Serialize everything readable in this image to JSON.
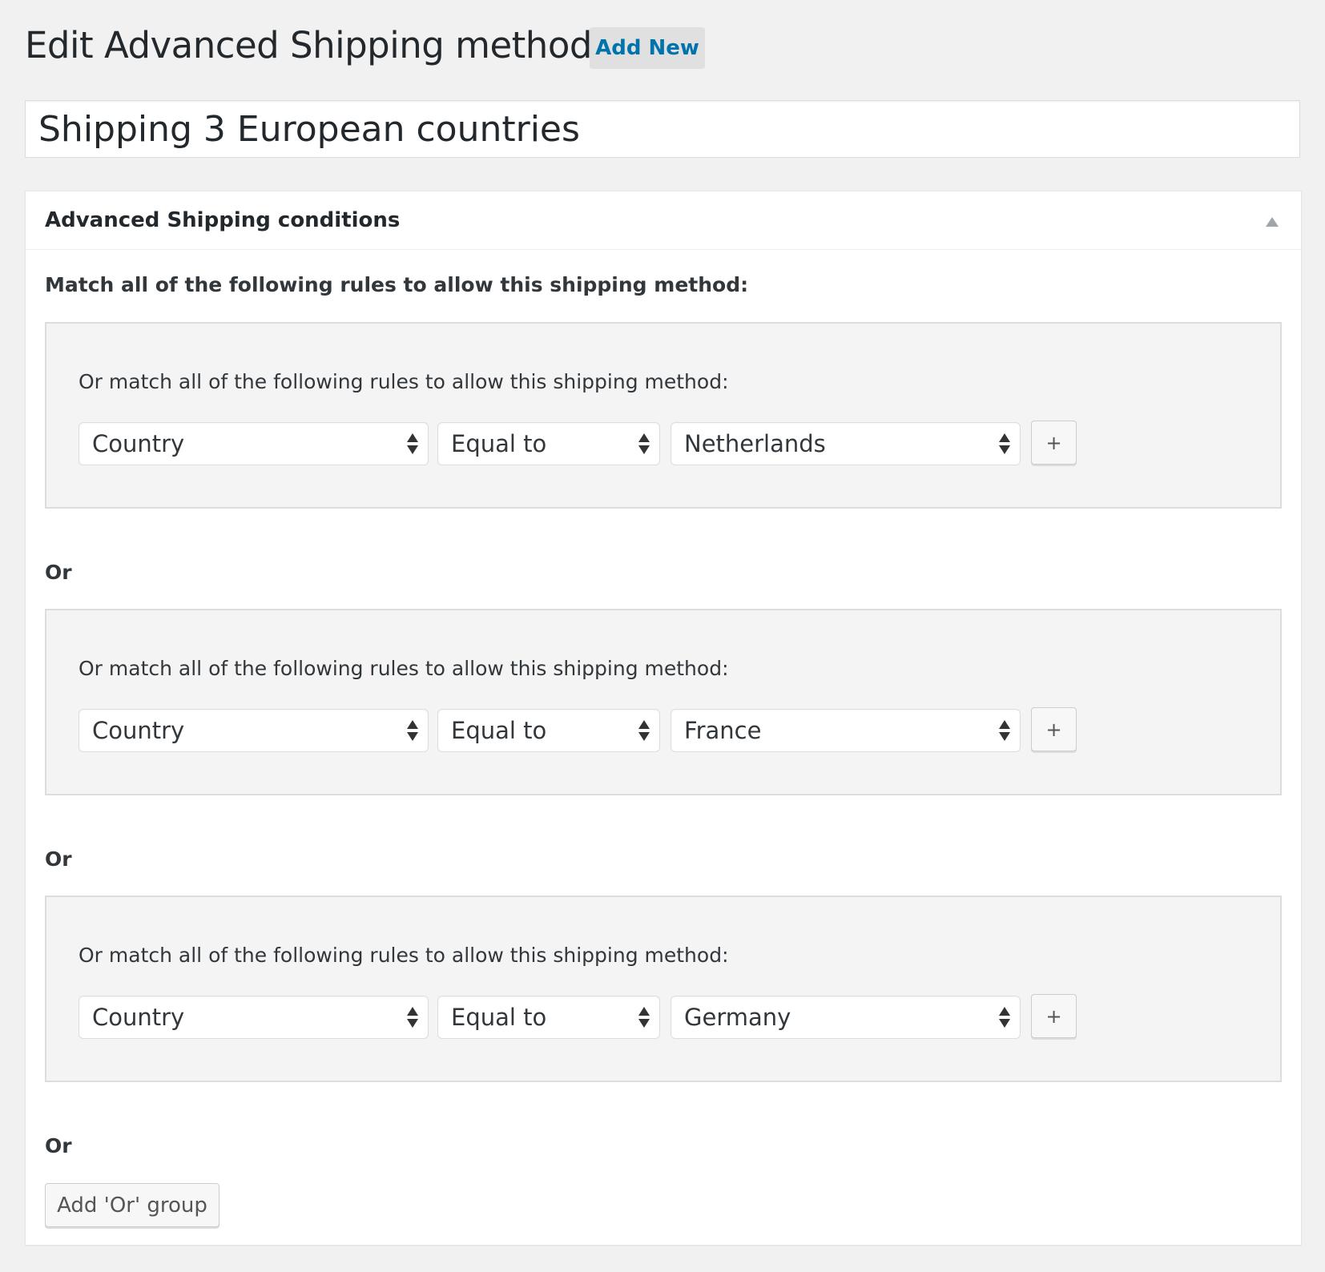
{
  "header": {
    "title": "Edit Advanced Shipping method",
    "add_new_label": "Add New"
  },
  "method": {
    "title_value": "Shipping 3 European countries"
  },
  "panel": {
    "title": "Advanced Shipping conditions",
    "intro": "Match all of the following rules to allow this shipping method:",
    "groups": [
      {
        "label": "Or match all of the following rules to allow this shipping method:",
        "rule": {
          "field": "Country",
          "operator": "Equal to",
          "value": "Netherlands"
        },
        "add_rule_label": "+"
      },
      {
        "label": "Or match all of the following rules to allow this shipping method:",
        "rule": {
          "field": "Country",
          "operator": "Equal to",
          "value": "France"
        },
        "add_rule_label": "+"
      },
      {
        "label": "Or match all of the following rules to allow this shipping method:",
        "rule": {
          "field": "Country",
          "operator": "Equal to",
          "value": "Germany"
        },
        "add_rule_label": "+"
      }
    ],
    "or_label": "Or",
    "add_or_group_label": "Add 'Or' group"
  }
}
